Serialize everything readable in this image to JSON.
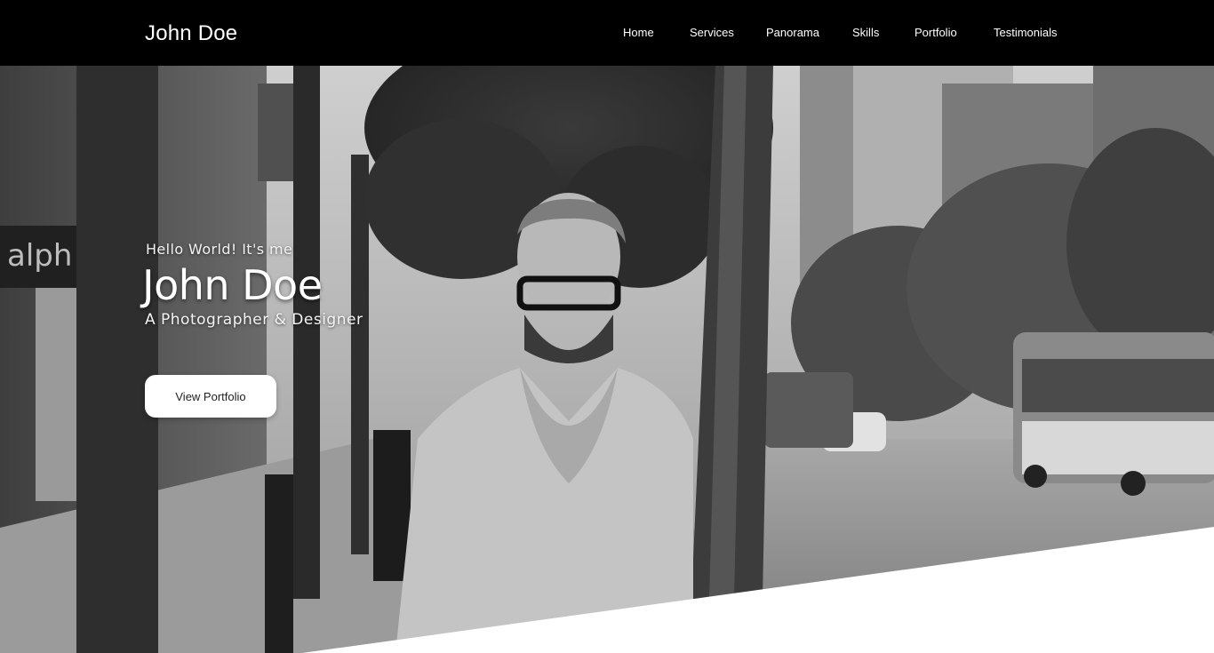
{
  "brand": {
    "name": "John Doe"
  },
  "nav": {
    "links": [
      "Home",
      "Services",
      "Panorama",
      "Skills",
      "Portfolio",
      "Testimonials"
    ]
  },
  "hero": {
    "greeting": "Hello World! It's me",
    "name": "John Doe",
    "tagline": "A Photographer & Designer",
    "cta_label": "View Portfolio",
    "photo_subject": "black-and-white street portrait of a man with glasses leaning on a tree"
  },
  "colors": {
    "navbar_bg": "#000000",
    "nav_text": "#ffffff",
    "button_bg": "#ffffff",
    "button_text": "#222222"
  }
}
